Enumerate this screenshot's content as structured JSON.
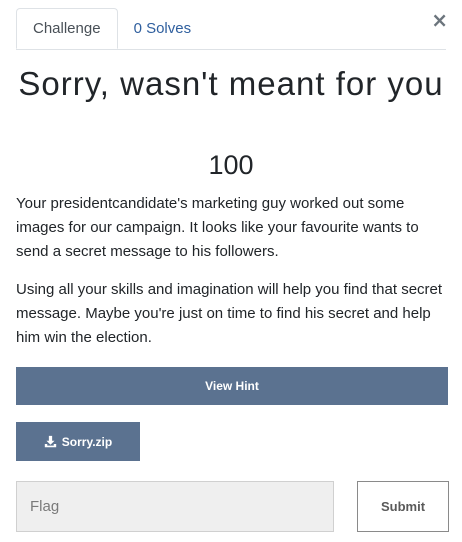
{
  "modal": {
    "close_label": "×",
    "tabs": [
      {
        "label": "Challenge",
        "active": true
      },
      {
        "label": "0 Solves",
        "active": false
      }
    ],
    "title": "Sorry, wasn't meant for you",
    "points": "100",
    "description": [
      "Your presidentcandidate's marketing guy worked out some images for our campaign. It looks like your favourite wants to send a secret message to his followers.",
      "Using all your skills and imagination will help you find that secret message. Maybe you're just on time to find his secret and help him win the election."
    ],
    "hint_button": "View Hint",
    "file": {
      "name": "Sorry.zip",
      "icon": "download-icon"
    },
    "flag_input": {
      "placeholder": "Flag",
      "value": ""
    },
    "submit_label": "Submit"
  },
  "colors": {
    "accent": "#5b7290",
    "link": "#2f5f9e"
  }
}
